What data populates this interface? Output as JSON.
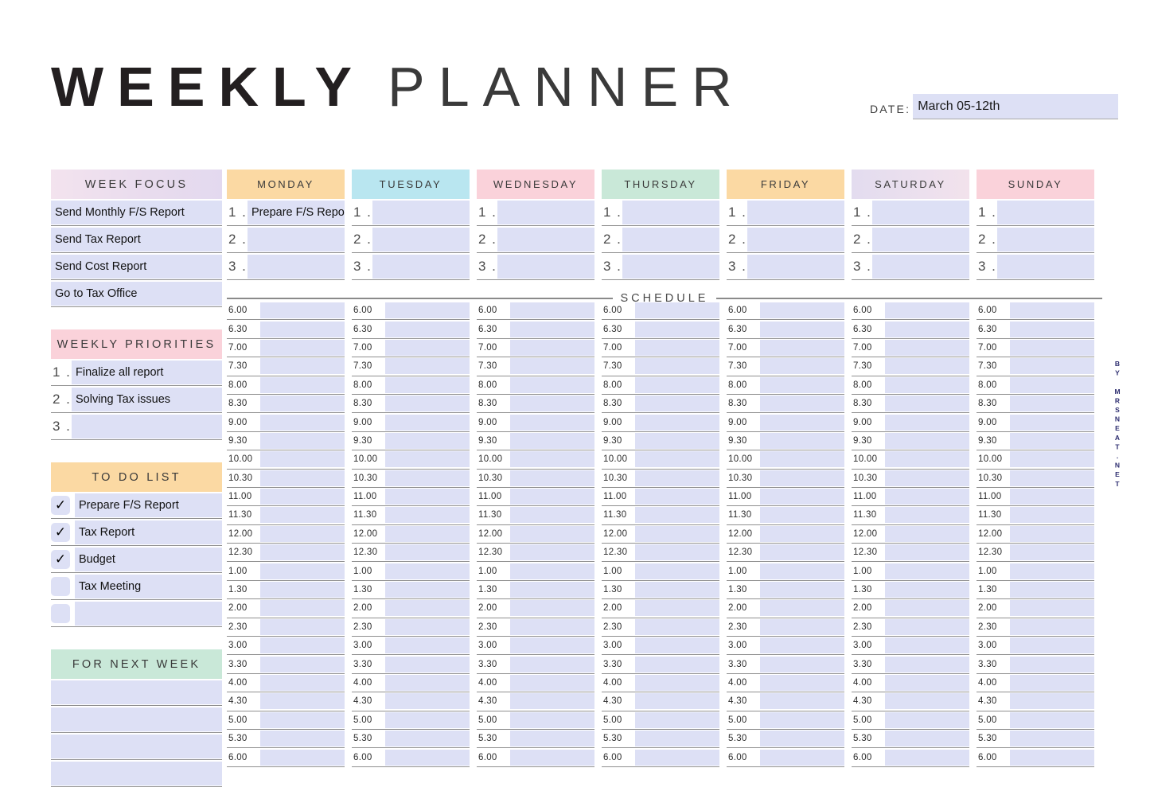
{
  "header": {
    "title_bold": "WEEKLY",
    "title_light": "PLANNER",
    "date_label": "DATE:",
    "date_value": "March 05-12th"
  },
  "credit": "BY MRSNEAT.NET",
  "schedule_label": "SCHEDULE",
  "sidebar": {
    "week_focus": {
      "title": "WEEK FOCUS",
      "color": "#e9dcee",
      "items": [
        "Send Monthly F/S Report",
        "Send Tax Report",
        "Send Cost Report",
        "Go to Tax Office"
      ]
    },
    "weekly_priorities": {
      "title": "WEEKLY PRIORITIES",
      "color": "#fad2da",
      "items": [
        {
          "num": "1 .",
          "text": "Finalize all report"
        },
        {
          "num": "2 .",
          "text": "Solving Tax issues"
        },
        {
          "num": "3 .",
          "text": ""
        }
      ]
    },
    "todo_list": {
      "title": "TO DO LIST",
      "color": "#fbd9a3",
      "check_glyph": "✓",
      "items": [
        {
          "checked": true,
          "text": "Prepare F/S Report"
        },
        {
          "checked": true,
          "text": "Tax Report"
        },
        {
          "checked": true,
          "text": "Budget"
        },
        {
          "checked": false,
          "text": "Tax Meeting"
        },
        {
          "checked": false,
          "text": ""
        }
      ]
    },
    "for_next_week": {
      "title": "FOR NEXT WEEK",
      "color": "#c9e8d8",
      "items": [
        "",
        "",
        "",
        ""
      ]
    }
  },
  "days": [
    {
      "label": "MONDAY",
      "color": "#fbd9a3",
      "tasks": [
        {
          "num": "1 .",
          "text": "Prepare F/S Report"
        },
        {
          "num": "2 .",
          "text": ""
        },
        {
          "num": "3 .",
          "text": ""
        }
      ]
    },
    {
      "label": "TUESDAY",
      "color": "#b9e6f0",
      "tasks": [
        {
          "num": "1 .",
          "text": ""
        },
        {
          "num": "2 .",
          "text": ""
        },
        {
          "num": "3 .",
          "text": ""
        }
      ]
    },
    {
      "label": "WEDNESDAY",
      "color": "#fad2da",
      "tasks": [
        {
          "num": "1 .",
          "text": ""
        },
        {
          "num": "2 .",
          "text": ""
        },
        {
          "num": "3 .",
          "text": ""
        }
      ]
    },
    {
      "label": "THURSDAY",
      "color": "#c9e8d8",
      "tasks": [
        {
          "num": "1 .",
          "text": ""
        },
        {
          "num": "2 .",
          "text": ""
        },
        {
          "num": "3 .",
          "text": ""
        }
      ]
    },
    {
      "label": "FRIDAY",
      "color": "#fbd9a3",
      "tasks": [
        {
          "num": "1 .",
          "text": ""
        },
        {
          "num": "2 .",
          "text": ""
        },
        {
          "num": "3 .",
          "text": ""
        }
      ]
    },
    {
      "label": "SATURDAY",
      "color": "#e5dcee",
      "tasks": [
        {
          "num": "1 .",
          "text": ""
        },
        {
          "num": "2 .",
          "text": ""
        },
        {
          "num": "3 .",
          "text": ""
        }
      ]
    },
    {
      "label": "SUNDAY",
      "color": "#fad2da",
      "tasks": [
        {
          "num": "1 .",
          "text": ""
        },
        {
          "num": "2 .",
          "text": ""
        },
        {
          "num": "3 .",
          "text": ""
        }
      ]
    }
  ],
  "time_slots": [
    "6.00",
    "6.30",
    "7.00",
    "7.30",
    "8.00",
    "8.30",
    "9.00",
    "9.30",
    "10.00",
    "10.30",
    "11.00",
    "11.30",
    "12.00",
    "12.30",
    "1.00",
    "1.30",
    "2.00",
    "2.30",
    "3.00",
    "3.30",
    "4.00",
    "4.30",
    "5.00",
    "5.30",
    "6.00"
  ],
  "schedule_entries": {
    "MONDAY": {},
    "TUESDAY": {},
    "WEDNESDAY": {},
    "THURSDAY": {},
    "FRIDAY": {},
    "SATURDAY": {},
    "SUNDAY": {}
  }
}
